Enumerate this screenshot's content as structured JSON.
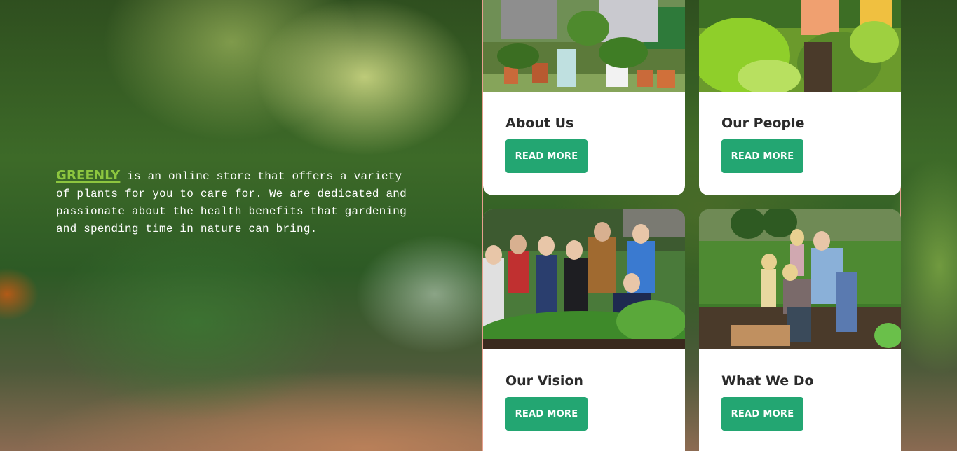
{
  "intro": {
    "brand": "GREENLY",
    "text": " is an online store that offers a variety of plants for you to care for. We are dedicated and passionate about the health benefits that gardening and spending time in nature can bring."
  },
  "cards": [
    {
      "title": "About Us",
      "button": "READ MORE"
    },
    {
      "title": "Our People",
      "button": "READ MORE"
    },
    {
      "title": "Our Vision",
      "button": "READ MORE"
    },
    {
      "title": "What We Do",
      "button": "READ MORE"
    }
  ],
  "colors": {
    "brand": "#8dc63f",
    "button": "#23a672",
    "card_background": "#ffffff",
    "title": "#2b2b2b"
  }
}
